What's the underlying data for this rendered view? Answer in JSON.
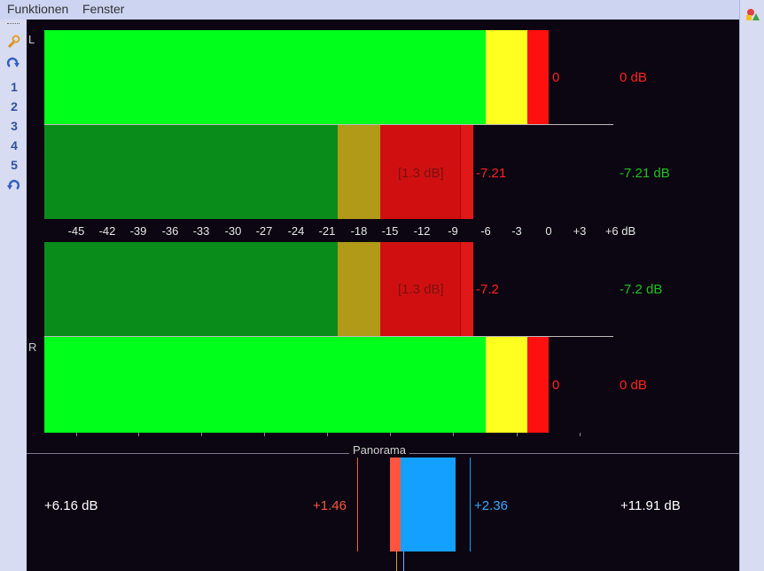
{
  "menu": {
    "items": [
      "Funktionen",
      "Fenster"
    ]
  },
  "toolbar": {
    "icons": [
      "wrench-icon",
      "redo-icon",
      "undo-icon"
    ],
    "numbers": [
      "1",
      "2",
      "3",
      "4",
      "5"
    ]
  },
  "channels": {
    "left": "L",
    "right": "R"
  },
  "meters": {
    "left_peak": {
      "value": "0",
      "db": "0 dB"
    },
    "left_rms": {
      "diff": "[1.3 dB]",
      "value": "-7.21",
      "db": "-7.21 dB"
    },
    "right_rms": {
      "diff": "[1.3 dB]",
      "value": "-7.2",
      "db": "-7.2 dB"
    },
    "right_peak": {
      "value": "0",
      "db": "0 dB"
    }
  },
  "scale": {
    "ticks": [
      "-45",
      "-42",
      "-39",
      "-36",
      "-33",
      "-30",
      "-27",
      "-24",
      "-21",
      "-18",
      "-15",
      "-12",
      "-9",
      "-6",
      "-3",
      "0",
      "+3",
      "+6 dB"
    ]
  },
  "panorama": {
    "title": "Panorama",
    "left_value": "+6.16 dB",
    "red_value": "+1.46",
    "blue_value": "+2.36",
    "right_value": "+11.91 dB"
  },
  "colors": {
    "bright_green": "#00ff1a",
    "dark_green": "#0a8c1a",
    "yellow": "#ffff20",
    "olive": "#b09a18",
    "red": "#ff1010",
    "dark_red": "#d01010",
    "pan_red": "#ff5540",
    "pan_blue": "#14a0ff"
  }
}
